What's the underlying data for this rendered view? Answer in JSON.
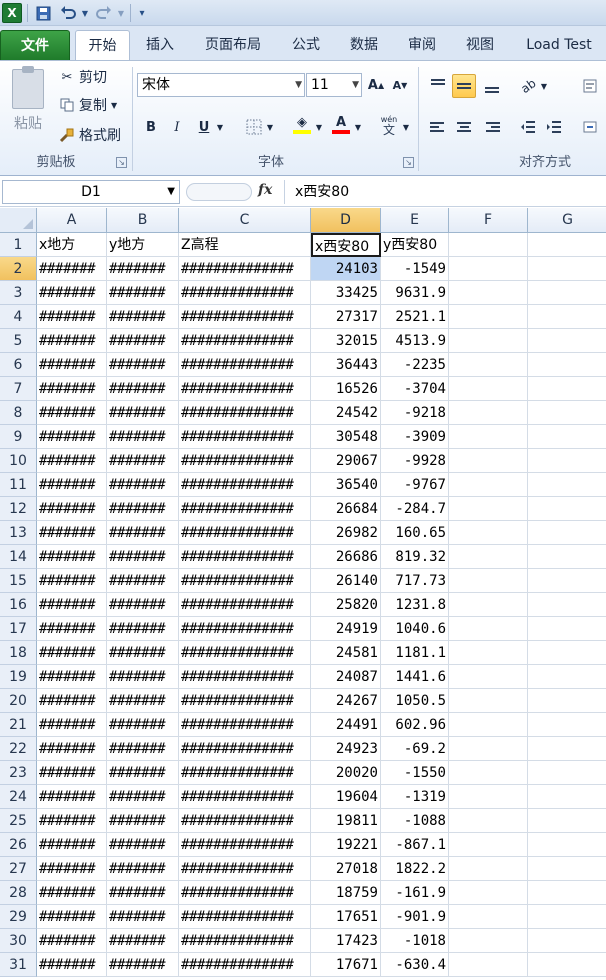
{
  "window": {
    "quick_access": [
      "excel-icon",
      "save-icon",
      "undo-icon",
      "redo-icon",
      "customize-icon"
    ]
  },
  "ribbon_tabs": [
    {
      "label": "文件"
    },
    {
      "label": "开始"
    },
    {
      "label": "插入"
    },
    {
      "label": "页面布局"
    },
    {
      "label": "公式"
    },
    {
      "label": "数据"
    },
    {
      "label": "审阅"
    },
    {
      "label": "视图"
    },
    {
      "label": "Load Test"
    }
  ],
  "clipboard": {
    "paste_label": "粘贴",
    "cut_label": "剪切",
    "copy_label": "复制",
    "format_painter_label": "格式刷",
    "group_label": "剪贴板"
  },
  "font": {
    "font_name": "宋体",
    "font_size": "11",
    "group_label": "字体",
    "grow_label": "A",
    "shrink_label": "A",
    "bold_label": "B",
    "italic_label": "I",
    "underline_label": "U",
    "fill_color": "#ffff00",
    "font_color": "#ff0000",
    "font_color_label": "A",
    "phonetic_label": "wén"
  },
  "alignment": {
    "group_label": "对齐方式"
  },
  "formula_bar": {
    "name_box": "D1",
    "fx_label": "fx",
    "formula": "x西安80"
  },
  "sheet": {
    "columns": [
      "A",
      "B",
      "C",
      "D",
      "E",
      "F",
      "G"
    ],
    "selected_column": "D",
    "active_cell": "D1",
    "selected_cell": "D2",
    "header_row": [
      "x地方",
      "y地方",
      "Z高程",
      "x西安80",
      "y西安80"
    ],
    "hash_short": "#######",
    "hash_long": "##############",
    "rows": [
      {
        "n": "2",
        "d": "24103",
        "e": "-1549"
      },
      {
        "n": "3",
        "d": "33425",
        "e": "9631.9"
      },
      {
        "n": "4",
        "d": "27317",
        "e": "2521.1"
      },
      {
        "n": "5",
        "d": "32015",
        "e": "4513.9"
      },
      {
        "n": "6",
        "d": "36443",
        "e": "-2235"
      },
      {
        "n": "7",
        "d": "16526",
        "e": "-3704"
      },
      {
        "n": "8",
        "d": "24542",
        "e": "-9218"
      },
      {
        "n": "9",
        "d": "30548",
        "e": "-3909"
      },
      {
        "n": "10",
        "d": "29067",
        "e": "-9928"
      },
      {
        "n": "11",
        "d": "36540",
        "e": "-9767"
      },
      {
        "n": "12",
        "d": "26684",
        "e": "-284.7"
      },
      {
        "n": "13",
        "d": "26982",
        "e": "160.65"
      },
      {
        "n": "14",
        "d": "26686",
        "e": "819.32"
      },
      {
        "n": "15",
        "d": "26140",
        "e": "717.73"
      },
      {
        "n": "16",
        "d": "25820",
        "e": "1231.8"
      },
      {
        "n": "17",
        "d": "24919",
        "e": "1040.6"
      },
      {
        "n": "18",
        "d": "24581",
        "e": "1181.1"
      },
      {
        "n": "19",
        "d": "24087",
        "e": "1441.6"
      },
      {
        "n": "20",
        "d": "24267",
        "e": "1050.5"
      },
      {
        "n": "21",
        "d": "24491",
        "e": "602.96"
      },
      {
        "n": "22",
        "d": "24923",
        "e": "-69.2"
      },
      {
        "n": "23",
        "d": "20020",
        "e": "-1550"
      },
      {
        "n": "24",
        "d": "19604",
        "e": "-1319"
      },
      {
        "n": "25",
        "d": "19811",
        "e": "-1088"
      },
      {
        "n": "26",
        "d": "19221",
        "e": "-867.1"
      },
      {
        "n": "27",
        "d": "27018",
        "e": "1822.2"
      },
      {
        "n": "28",
        "d": "18759",
        "e": "-161.9"
      },
      {
        "n": "29",
        "d": "17651",
        "e": "-901.9"
      },
      {
        "n": "30",
        "d": "17423",
        "e": "-1018"
      },
      {
        "n": "31",
        "d": "17671",
        "e": "-630.4"
      }
    ]
  },
  "colors": {
    "file_tab": "#1f7b2b",
    "selection_header": "#f1c15f",
    "selected_cell": "#bfd6f3"
  }
}
